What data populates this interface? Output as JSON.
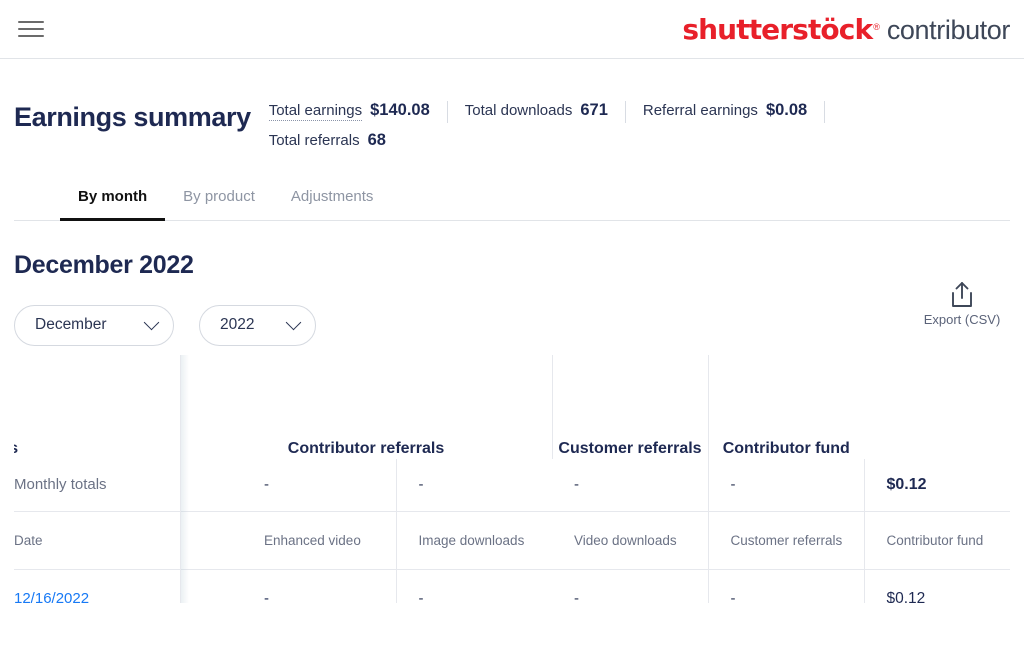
{
  "topbar": {
    "menu_icon": "hamburger-menu-icon",
    "brand_mark": "shutterstöck",
    "brand_registered": "®",
    "brand_sub": "contributor",
    "brand_color": "#e8202a",
    "brand_sub_color": "#3e4758"
  },
  "summary": {
    "title": "Earnings summary",
    "metrics": [
      {
        "label": "Total earnings",
        "value": "$140.08"
      },
      {
        "label": "Total downloads",
        "value": "671"
      },
      {
        "label": "Referral earnings",
        "value": "$0.08"
      },
      {
        "label": "Total referrals",
        "value": "68"
      }
    ]
  },
  "tabs": [
    {
      "label": "By month",
      "active": true
    },
    {
      "label": "By product",
      "active": false
    },
    {
      "label": "Adjustments",
      "active": false
    }
  ],
  "period": {
    "title": "December 2022",
    "month_select": {
      "value": "December",
      "icon": "chevron-down-icon"
    },
    "year_select": {
      "value": "2022",
      "icon": "chevron-down-icon"
    }
  },
  "export": {
    "label": "Export (CSV)",
    "icon": "export-upload-icon"
  },
  "table": {
    "group_headers": [
      {
        "label": "s"
      },
      {
        "label": "Contributor referrals"
      },
      {
        "label": "Customer referrals"
      },
      {
        "label": "Contributor fund"
      }
    ],
    "totals": {
      "label": "Monthly totals",
      "enhanced_video": "-",
      "image_downloads": "-",
      "video_downloads": "-",
      "customer_referrals": "-",
      "contributor_fund": "$0.12"
    },
    "columns": [
      "Date",
      "Enhanced video",
      "Image downloads",
      "Video downloads",
      "Customer referrals",
      "Contributor fund"
    ],
    "rows": [
      {
        "date": "12/16/2022",
        "enhanced_video": "-",
        "image_downloads": "-",
        "video_downloads": "-",
        "customer_referrals": "-",
        "contributor_fund": "$0.12"
      }
    ]
  },
  "colors": {
    "brand_red": "#e8202a",
    "link_blue": "#1779f5",
    "text_navy": "#1e2952",
    "text_muted": "#6b7285",
    "border": "#e6e8ed"
  }
}
